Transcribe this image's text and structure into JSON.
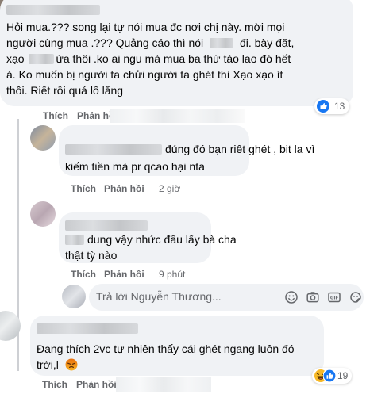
{
  "comments": [
    {
      "lines": [
        "Hỏi mua.??? song lại tự nói mua đc nơi chị này. mời mọi",
        "người cùng mua .??? Quảng cáo thì nói",
        "đi. bày đặt,",
        "xạo",
        "ừa thôi .ko ai ngu mà mua ba thứ tào lao đó hết",
        "á. Ko muốn bị người ta chửi người ta ghét thì Xạo xạo ít",
        "thôi. Riết rồi quá lố lăng"
      ],
      "like_label": "Thích",
      "reply_label": "Phản hồi",
      "reaction_count": "13",
      "reaction_icons": [
        "like-icon"
      ]
    },
    {
      "lines": [
        "đúng đó bạn riêt ghét , bit la vì",
        "kiếm tiền mà pr qcao hại nta"
      ],
      "like_label": "Thích",
      "reply_label": "Phản hồi",
      "time": "2 giờ"
    },
    {
      "lines": [
        "dung vậy nhức đầu lấy bà cha",
        "thật tỳ nào"
      ],
      "like_label": "Thích",
      "reply_label": "Phản hồi",
      "time": "9 phút"
    },
    {
      "lines": [
        "Đang thích 2vc tự nhiên thấy cái ghét ngang luôn đó",
        "trời,l"
      ],
      "like_label": "Thích",
      "reply_label": "Phản hồi",
      "reaction_count": "19",
      "reaction_icons": [
        "haha-icon",
        "like-icon"
      ]
    }
  ],
  "reply_box": {
    "placeholder": "Trả lời Nguyễn Thương...",
    "icons": [
      "emoji-icon",
      "camera-icon",
      "gif-icon",
      "sticker-icon"
    ]
  },
  "colors": {
    "bubble": "#f0f2f5",
    "meta_text": "#65676b",
    "like_blue": "#1877f2",
    "haha_yellow": "#f7b928",
    "angry_red": "#e9710f"
  }
}
